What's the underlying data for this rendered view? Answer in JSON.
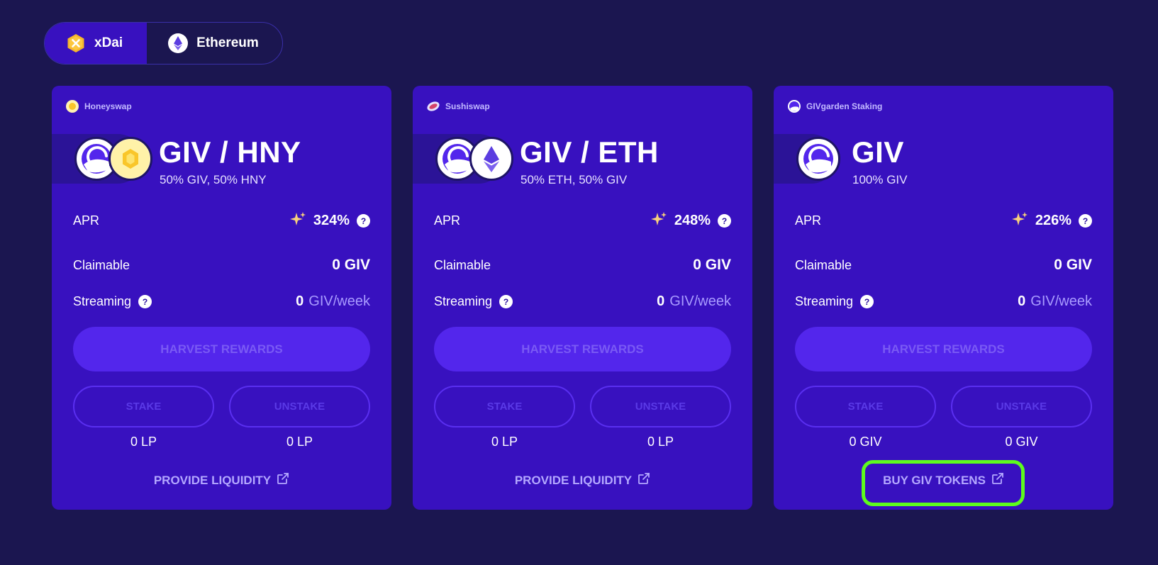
{
  "networks": [
    {
      "label": "xDai",
      "active": true,
      "icon": "xdai-icon"
    },
    {
      "label": "Ethereum",
      "active": false,
      "icon": "ethereum-icon"
    }
  ],
  "cards": [
    {
      "platform": "Honeyswap",
      "title": "GIV / HNY",
      "subtitle": "50% GIV, 50% HNY",
      "apr_label": "APR",
      "apr": "324%",
      "claimable_label": "Claimable",
      "claimable": "0 GIV",
      "streaming_label": "Streaming",
      "streaming_value": "0",
      "streaming_unit": "GIV/week",
      "harvest_label": "HARVEST REWARDS",
      "stake_label": "STAKE",
      "unstake_label": "UNSTAKE",
      "stake_amount": "0 LP",
      "unstake_amount": "0 LP",
      "link_label": "PROVIDE LIQUIDITY"
    },
    {
      "platform": "Sushiswap",
      "title": "GIV / ETH",
      "subtitle": "50% ETH, 50% GIV",
      "apr_label": "APR",
      "apr": "248%",
      "claimable_label": "Claimable",
      "claimable": "0 GIV",
      "streaming_label": "Streaming",
      "streaming_value": "0",
      "streaming_unit": "GIV/week",
      "harvest_label": "HARVEST REWARDS",
      "stake_label": "STAKE",
      "unstake_label": "UNSTAKE",
      "stake_amount": "0 LP",
      "unstake_amount": "0 LP",
      "link_label": "PROVIDE LIQUIDITY"
    },
    {
      "platform": "GIVgarden Staking",
      "title": "GIV",
      "subtitle": "100% GIV",
      "apr_label": "APR",
      "apr": "226%",
      "claimable_label": "Claimable",
      "claimable": "0 GIV",
      "streaming_label": "Streaming",
      "streaming_value": "0",
      "streaming_unit": "GIV/week",
      "harvest_label": "HARVEST REWARDS",
      "stake_label": "STAKE",
      "unstake_label": "UNSTAKE",
      "stake_amount": "0 GIV",
      "unstake_amount": "0 GIV",
      "link_label": "BUY GIV TOKENS"
    }
  ],
  "colors": {
    "background": "#1b1650",
    "card": "#3811bf",
    "highlight": "#5dfc1d"
  },
  "question_mark": "?"
}
